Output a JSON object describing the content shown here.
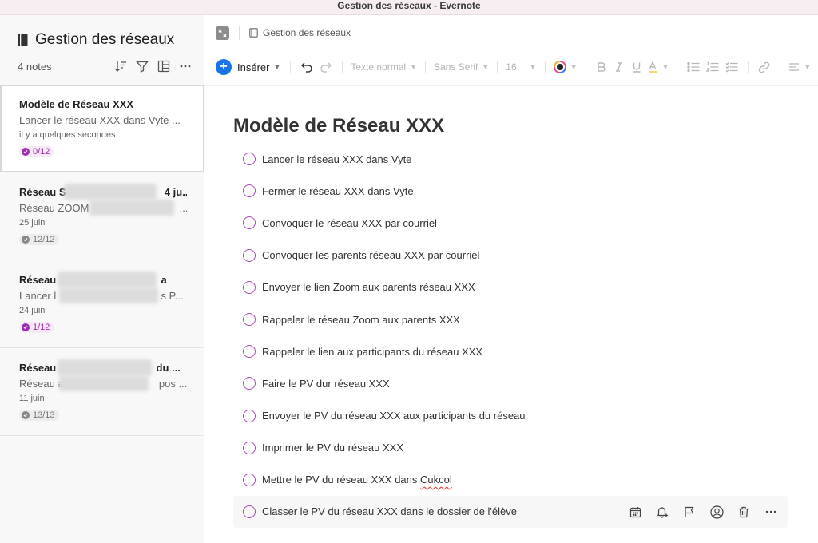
{
  "window": {
    "title": "Gestion des réseaux - Evernote"
  },
  "sidebar": {
    "notebook_title": "Gestion des réseaux",
    "notes_count": "4 notes",
    "notes": [
      {
        "title": "Modèle de Réseau XXX",
        "snippet": "Lancer le réseau XXX dans Vyte ...",
        "date": "il y a quelques secondes",
        "progress": "0/12",
        "selected": true
      },
      {
        "title_start": "Réseau S",
        "title_end": "4 ju...",
        "snippet_start": "Réseau ZOOM",
        "snippet_end": "...",
        "date": "25 juin",
        "progress": "12/12"
      },
      {
        "title_start": "Réseau",
        "title_end": "a",
        "snippet_start": "Lancer l",
        "snippet_end": "s P...",
        "date": "24 juin",
        "progress": "1/12"
      },
      {
        "title_start": "Réseau",
        "title_end": "du ...",
        "snippet_start": "Réseau a",
        "snippet_end": "pos ...",
        "date": "11 juin",
        "progress": "13/13"
      }
    ]
  },
  "editor": {
    "breadcrumb": "Gestion des réseaux",
    "toolbar": {
      "insert_label": "Insérer",
      "text_style": "Texte normal",
      "font_family": "Sans Serif",
      "font_size": "16"
    },
    "note_title": "Modèle de Réseau XXX",
    "tasks": [
      "Lancer le réseau  XXX dans Vyte",
      "Fermer le réseau XXX dans Vyte",
      "Convoquer  le réseau XXX par courriel",
      "Convoquer les parents réseau  XXX par courriel",
      "Envoyer le lien Zoom aux parents réseau XXX",
      "Rappeler le réseau Zoom aux parents XXX",
      "Rappeler le lien aux participants du réseau XXX",
      "Faire le PV dur réseau XXX",
      "Envoyer le PV du réseau XXX aux participants du réseau",
      "Imprimer le PV du réseau XXX"
    ],
    "task_11_start": "Mettre le PV du réseau XXX dans ",
    "task_11_misspelled": "Cukcol",
    "task_12": "Classer le PV du réseau XXX dans le dossier de l'élève"
  },
  "colors": {
    "accent_blue": "#1a73e8",
    "task_purple": "#a74bbf",
    "badge_purple": "#9b2fae",
    "highlight_yellow": "#f5c542"
  }
}
